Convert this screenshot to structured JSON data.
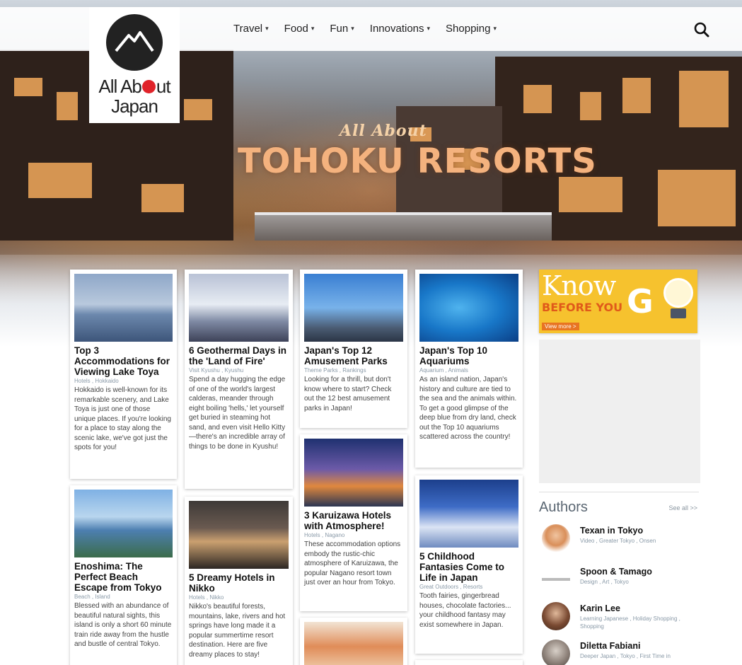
{
  "nav": {
    "logo_text_1": "All Ab",
    "logo_text_1b": "ut",
    "logo_text_2": "Japan",
    "items": [
      {
        "label": "Travel"
      },
      {
        "label": "Food"
      },
      {
        "label": "Fun"
      },
      {
        "label": "Innovations"
      },
      {
        "label": "Shopping"
      }
    ]
  },
  "hero": {
    "subtitle": "All About",
    "title": "TOHOKU RESORTS"
  },
  "articles": [
    {
      "title": "Top 3 Accommodations for Viewing Lake Toya",
      "tags": "Hotels , Hokkaido",
      "desc": "Hokkaido is well-known for its remarkable scenery, and Lake Toya is just one of those unique places. If you're looking for a place to stay along the scenic lake, we've got just the spots for you!"
    },
    {
      "title": "6 Geothermal Days in the 'Land of Fire'",
      "tags": "Visit Kyushu , Kyushu",
      "desc": "Spend a day hugging the edge of one of the world's largest calderas, meander through eight boiling 'hells,' let yourself get buried in steaming hot sand, and even visit Hello Kitty—there's an incredible array of things to be done in Kyushu!"
    },
    {
      "title": "Japan's Top 12 Amusement Parks",
      "tags": "Theme Parks , Rankings",
      "desc": "Looking for a thrill, but don't know where to start? Check out the 12 best amusement parks in Japan!"
    },
    {
      "title": "Japan's Top 10 Aquariums",
      "tags": "Aquarium , Animals",
      "desc": "As an island nation, Japan's history and culture are tied to the sea and the animals within. To get a good glimpse of the deep blue from dry land, check out the Top 10 aquariums scattered across the country!"
    },
    {
      "title": "Enoshima: The Perfect Beach Escape from Tokyo",
      "tags": "Beach , Island",
      "desc": "Blessed with an abundance of beautiful natural sights, this island is only a short 60 minute train ride away from the hustle and bustle of central Tokyo."
    },
    {
      "title": "5 Dreamy Hotels in Nikko",
      "tags": "Hotels , Nikko",
      "desc": "Nikko's beautiful forests, mountains, lake, rivers and hot springs have long made it a popular summertime resort destination. Here are five dreamy places to stay!"
    },
    {
      "title": "3 Karuizawa Hotels with Atmosphere!",
      "tags": "Hotels , Nagano",
      "desc": "These accommodation options embody the rustic-chic atmosphere of Karuizawa, the popular Nagano resort town just over an hour from Tokyo."
    },
    {
      "title": "5 Childhood Fantasies Come to Life in Japan",
      "tags": "Great Outdoors , Resorts",
      "desc": "Tooth fairies, gingerbread houses, chocolate factories... your childhood fantasy may exist somewhere in Japan."
    }
  ],
  "ad": {
    "know": "Know",
    "before_you": "BEFORE YOU",
    "go": "G",
    "view_more": "View more >"
  },
  "authors": {
    "heading": "Authors",
    "see_all": "See all >>",
    "list": [
      {
        "name": "Texan in Tokyo",
        "tags": "Video , Greater Tokyo , Onsen"
      },
      {
        "name": "Spoon & Tamago",
        "tags": "Design , Art , Tokyo"
      },
      {
        "name": "Karin Lee",
        "tags": "Learning Japanese , Holiday Shopping , Shopping"
      },
      {
        "name": "Diletta Fabiani",
        "tags": "Deeper Japan , Tokyo , First Time in"
      }
    ]
  },
  "colors": {
    "accent_red": "#e0232a",
    "hero_title": "#f4b27e",
    "ad_yellow": "#f6c22e"
  }
}
